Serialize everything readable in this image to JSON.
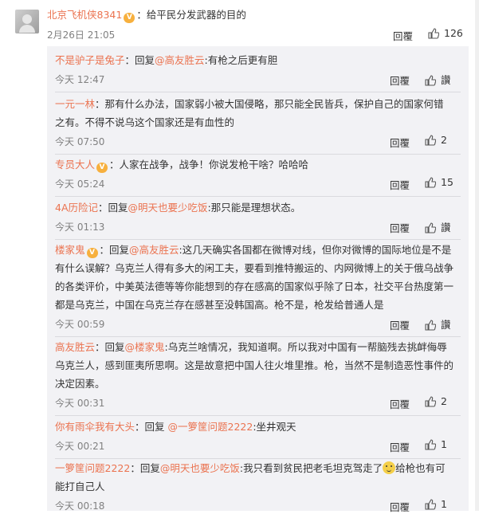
{
  "main_comment": {
    "username": "北京飞机侠8341",
    "badge_icon": "vip-badge-icon",
    "separator": "：",
    "text": "给平民分发武器的目的",
    "time": "2月26日 21:05",
    "reply_label": "回覆",
    "likes": "126"
  },
  "replies": [
    {
      "username": "不是驴子是兔子",
      "badge": false,
      "prefix": "：回复",
      "mention": "@高友胜云",
      "mention_sep": ":",
      "text": "有枪之后更有胆",
      "time": "今天 12:47",
      "reply_label": "回覆",
      "likes": "讚"
    },
    {
      "username": "一元一林",
      "badge": false,
      "prefix": "：",
      "mention": "",
      "mention_sep": "",
      "text": "那有什么办法，国家弱小被大国侵略，那只能全民皆兵，保护自己的国家何错之有。不得不说乌这个国家还是有血性的",
      "time": "今天 07:50",
      "reply_label": "回覆",
      "likes": "2"
    },
    {
      "username": "专员大人",
      "badge": true,
      "prefix": "：",
      "mention": "",
      "mention_sep": "",
      "text": "人家在战争，战争！你说发枪干啥？哈哈哈",
      "time": "今天 05:24",
      "reply_label": "回覆",
      "likes": "15"
    },
    {
      "username": "4A历险记",
      "badge": false,
      "prefix": "：回复",
      "mention": "@明天也要少吃饭",
      "mention_sep": ":",
      "text": "那只能是理想状态。",
      "time": "今天 01:13",
      "reply_label": "回覆",
      "likes": "讚"
    },
    {
      "username": "楼家鬼",
      "badge": true,
      "prefix": "：回复",
      "mention": "@高友胜云",
      "mention_sep": ":",
      "text": "这几天确实各国都在微博对线，但你对微博的国际地位是不是有什么误解？乌克兰人得有多大的闲工夫，要看到推特搬运的、内网微博上的关于俄乌战争的各类评价，中美英法德等等你能想到的存在感高的国家似乎除了日本，社交平台热度第一都是乌克兰，中国在乌克兰存在感甚至没韩国高。枪不是，枪发给普通人是",
      "time": "今天 00:59",
      "reply_label": "回覆",
      "likes": "讚"
    },
    {
      "username": "高友胜云",
      "badge": false,
      "prefix": "：回复",
      "mention": "@楼家鬼",
      "mention_sep": ":",
      "text": "乌克兰啥情况，我知道啊。所以我对中国有一帮脑残去挑衅侮辱乌克兰人，感到匪夷所思啊。这是故意把中国人往火堆里推。枪，当然不是制造恶性事件的决定因素。",
      "time": "今天 00:31",
      "reply_label": "回覆",
      "likes": "2"
    },
    {
      "username": "你有雨伞我有大头",
      "badge": false,
      "prefix": "：回复 ",
      "mention": "@一箩筐问题2222",
      "mention_sep": ":",
      "text": "坐井观天",
      "time": "今天 00:21",
      "reply_label": "回覆",
      "likes": "1"
    },
    {
      "username": "一箩筐问题2222",
      "badge": false,
      "prefix": "：回复",
      "mention": "@明天也要少吃饭",
      "mention_sep": ":",
      "text": "我只看到贫民把老毛坦克驾走了",
      "text2": "给枪也有可能打自己人",
      "time": "今天 00:18",
      "reply_label": "回覆",
      "likes": "1"
    }
  ],
  "colors": {
    "username": "#eb7350",
    "meta": "#808080",
    "subbg": "#f2f2f5",
    "text": "#333333"
  }
}
